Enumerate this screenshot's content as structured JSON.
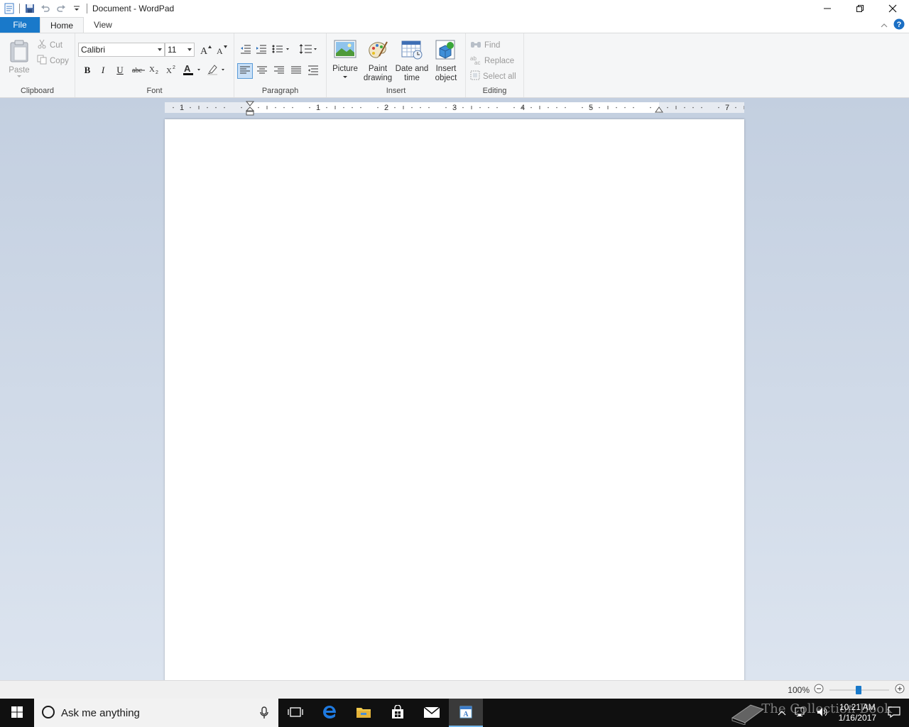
{
  "window": {
    "title": "Document - WordPad"
  },
  "tabs": [
    {
      "label": "File"
    },
    {
      "label": "Home"
    },
    {
      "label": "View"
    }
  ],
  "ribbon": {
    "clipboard": {
      "label": "Clipboard",
      "paste": "Paste",
      "cut": "Cut",
      "copy": "Copy"
    },
    "font": {
      "label": "Font",
      "family": "Calibri",
      "size": "11"
    },
    "paragraph": {
      "label": "Paragraph"
    },
    "insert": {
      "label": "Insert",
      "picture": "Picture",
      "paint_line1": "Paint",
      "paint_line2": "drawing",
      "datetime_line1": "Date and",
      "datetime_line2": "time",
      "object_line1": "Insert",
      "object_line2": "object"
    },
    "editing": {
      "label": "Editing",
      "find": "Find",
      "replace": "Replace",
      "select_all": "Select all"
    }
  },
  "ruler": {
    "labels": [
      "1",
      "1",
      "2",
      "3",
      "4",
      "5",
      "7"
    ]
  },
  "status": {
    "zoom": "100%"
  },
  "taskbar": {
    "search_placeholder": "Ask me anything",
    "time": "10:21 AM",
    "date": "1/16/2017",
    "watermark": "The Collection Book"
  },
  "colors": {
    "file_tab": "#1979ca",
    "ribbon_bg": "#f5f6f7",
    "workspace_top": "#c3cfe0",
    "taskbar": "#101010"
  }
}
